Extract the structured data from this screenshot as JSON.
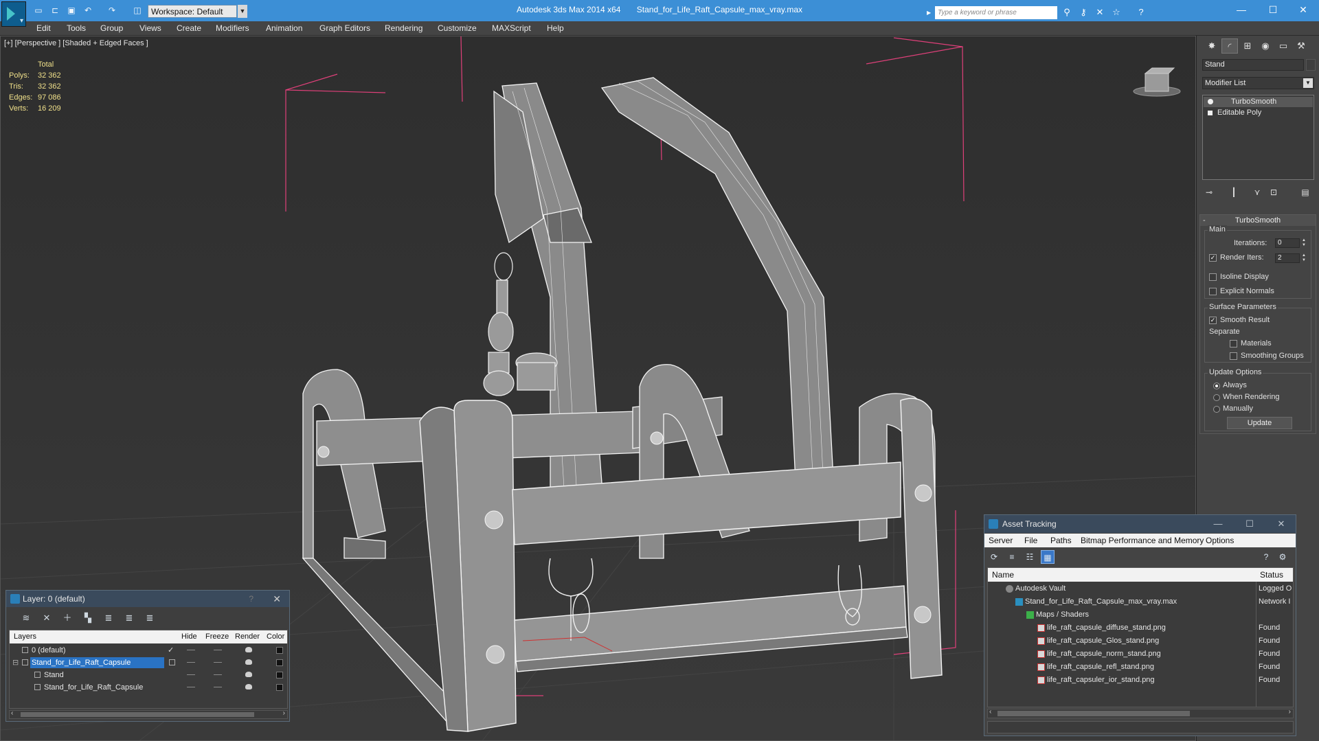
{
  "titlebar": {
    "app": "Autodesk 3ds Max  2014 x64",
    "file": "Stand_for_Life_Raft_Capsule_max_vray.max",
    "workspace": "Workspace: Default",
    "search_placeholder": "Type a keyword or phrase"
  },
  "menu": [
    "Edit",
    "Tools",
    "Group",
    "Views",
    "Create",
    "Modifiers",
    "Animation",
    "Graph Editors",
    "Rendering",
    "Customize",
    "MAXScript",
    "Help"
  ],
  "viewport": {
    "label": "[+] [Perspective ] [Shaded + Edged Faces ]",
    "stats": {
      "total_label": "Total",
      "polys_label": "Polys:",
      "polys": "32 362",
      "tris_label": "Tris:",
      "tris": "32 362",
      "edges_label": "Edges:",
      "edges": "97 086",
      "verts_label": "Verts:",
      "verts": "16 209"
    }
  },
  "command_panel": {
    "object_name": "Stand",
    "modifier_list": "Modifier List",
    "stack": [
      "TurboSmooth",
      "Editable Poly"
    ],
    "rollout": {
      "title": "TurboSmooth",
      "main_group": "Main",
      "iterations_label": "Iterations:",
      "iterations": "0",
      "render_iters_label": "Render Iters:",
      "render_iters": "2",
      "isoline": "Isoline Display",
      "explicit_normals": "Explicit Normals",
      "surface_group": "Surface Parameters",
      "smooth_result": "Smooth Result",
      "separate": "Separate",
      "materials": "Materials",
      "smoothing_groups": "Smoothing Groups",
      "update_group": "Update Options",
      "always": "Always",
      "when_rendering": "When Rendering",
      "manually": "Manually",
      "update_button": "Update"
    }
  },
  "layer_window": {
    "title": "Layer: 0 (default)",
    "help": "?",
    "columns": [
      "Layers",
      "Hide",
      "Freeze",
      "Render",
      "Color"
    ],
    "rows": [
      {
        "name": "0 (default)"
      },
      {
        "name": "Stand_for_Life_Raft_Capsule"
      },
      {
        "name": "Stand"
      },
      {
        "name": "Stand_for_Life_Raft_Capsule"
      }
    ]
  },
  "asset_tracking": {
    "title": "Asset Tracking",
    "menu": [
      "Server",
      "File",
      "Paths",
      "Bitmap Performance and Memory",
      "Options"
    ],
    "columns": [
      "Name",
      "Status"
    ],
    "rows": [
      {
        "name": "Autodesk Vault",
        "status": "Logged O"
      },
      {
        "name": "Stand_for_Life_Raft_Capsule_max_vray.max",
        "status": "Network I"
      },
      {
        "name": "Maps / Shaders",
        "status": ""
      },
      {
        "name": "life_raft_capsule_diffuse_stand.png",
        "status": "Found"
      },
      {
        "name": "life_raft_capsule_Glos_stand.png",
        "status": "Found"
      },
      {
        "name": "life_raft_capsule_norm_stand.png",
        "status": "Found"
      },
      {
        "name": "life_raft_capsule_refl_stand.png",
        "status": "Found"
      },
      {
        "name": "life_raft_capsuler_ior_stand.png",
        "status": "Found"
      }
    ]
  },
  "colors": {
    "titlebar": "#3c8fd6",
    "selection": "#2a73c4",
    "stats_text": "#f0e08a",
    "bbox_corners": "#e0407a"
  }
}
